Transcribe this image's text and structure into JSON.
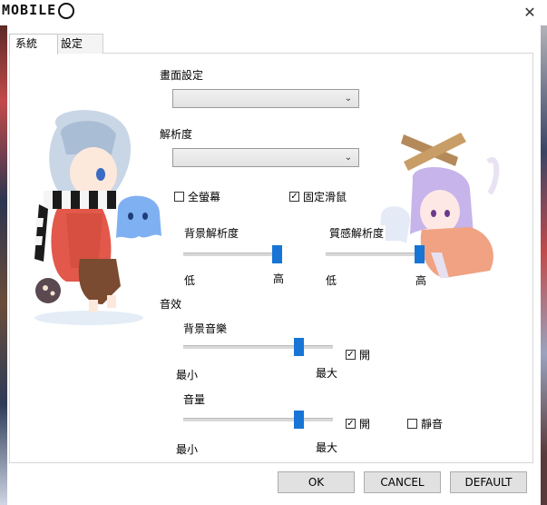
{
  "window": {
    "logo_text": "MOBILE",
    "close_glyph": "✕"
  },
  "tabs": [
    {
      "label": "系統",
      "active": true
    },
    {
      "label": "設定",
      "active": false
    }
  ],
  "display": {
    "section_label": "畫面設定",
    "section_value": "",
    "resolution_label": "解析度",
    "resolution_value": "",
    "fullscreen_label": "全螢幕",
    "fullscreen_checked": false,
    "lock_mouse_label": "固定滑鼠",
    "lock_mouse_checked": true,
    "bg_res_label": "背景解析度",
    "bg_res_low": "低",
    "bg_res_high": "高",
    "bg_res_level": 0.98,
    "tex_res_label": "質感解析度",
    "tex_res_low": "低",
    "tex_res_high": "高",
    "tex_res_level": 0.98
  },
  "sound": {
    "section_label": "音效",
    "bgm_label": "背景音樂",
    "bgm_min": "最小",
    "bgm_max": "最大",
    "bgm_level": 0.77,
    "bgm_on_label": "開",
    "bgm_on_checked": true,
    "volume_label": "音量",
    "volume_min": "最小",
    "volume_max": "最大",
    "volume_level": 0.77,
    "volume_on_label": "開",
    "volume_on_checked": true,
    "mute_label": "靜音",
    "mute_checked": false
  },
  "buttons": {
    "ok": "OK",
    "cancel": "CANCEL",
    "default": "DEFAULT"
  },
  "colors": {
    "slider_thumb": "#1875d6",
    "button_bg": "#e1e1e1"
  },
  "icons": {
    "dropdown": "chevron-down-icon",
    "close": "close-icon"
  }
}
